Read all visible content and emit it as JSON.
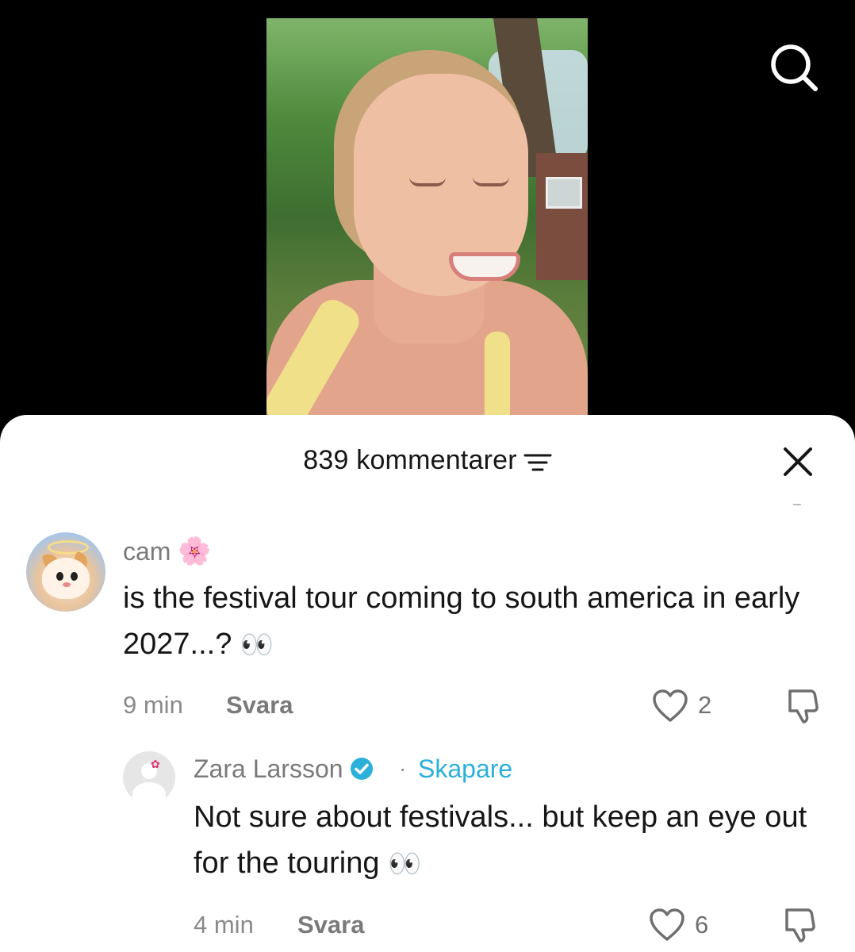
{
  "icons": {
    "search": "search-icon",
    "filter": "filter-icon",
    "close": "close-icon",
    "like": "heart-outline-icon",
    "dislike": "thumbs-down-icon",
    "verified": "verified-badge-icon"
  },
  "colors": {
    "creator_accent": "#2BB0D9",
    "sheet_bg": "#FFFFFF",
    "page_bg": "#000000"
  },
  "sheet": {
    "comment_count_label": "839 kommentarer"
  },
  "comments": [
    {
      "username": "cam",
      "username_emoji": "🌸",
      "text": "is the festival tour coming to south america in early 2027...?",
      "text_emoji": "👀",
      "time": "9 min",
      "reply_label": "Svara",
      "likes": "2"
    },
    {
      "username": "Zara Larsson",
      "verified": true,
      "separator": "·",
      "creator_label": "Skapare",
      "text": "Not sure about festivals... but keep an eye out for the touring",
      "text_emoji": "👀",
      "time": "4 min",
      "reply_label": "Svara",
      "likes": "6"
    }
  ]
}
